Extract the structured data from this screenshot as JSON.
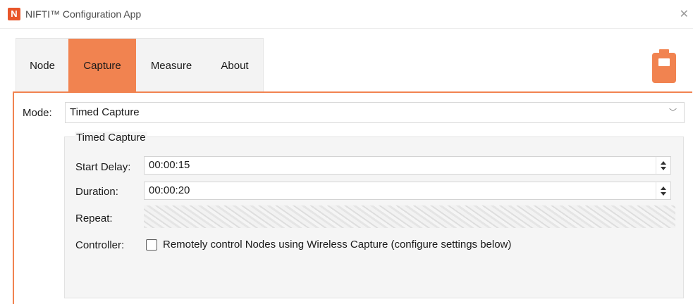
{
  "window": {
    "icon_letter": "N",
    "title": "NIFTI™ Configuration App",
    "close_glyph": "✕"
  },
  "tabs": [
    {
      "label": "Node",
      "active": false
    },
    {
      "label": "Capture",
      "active": true
    },
    {
      "label": "Measure",
      "active": false
    },
    {
      "label": "About",
      "active": false
    }
  ],
  "status": {
    "battery_icon": "battery-icon",
    "accent_color": "#f18350"
  },
  "mode": {
    "label": "Mode:",
    "value": "Timed Capture",
    "chevron": "﹀"
  },
  "timed_capture": {
    "title": "Timed Capture",
    "start_delay_label": "Start Delay:",
    "start_delay_value": "00:00:15",
    "duration_label": "Duration:",
    "duration_value": "00:00:20",
    "repeat_label": "Repeat:",
    "controller_label": "Controller:",
    "controller_checkbox_label": "Remotely control Nodes using Wireless Capture (configure settings below)",
    "controller_checked": false
  }
}
